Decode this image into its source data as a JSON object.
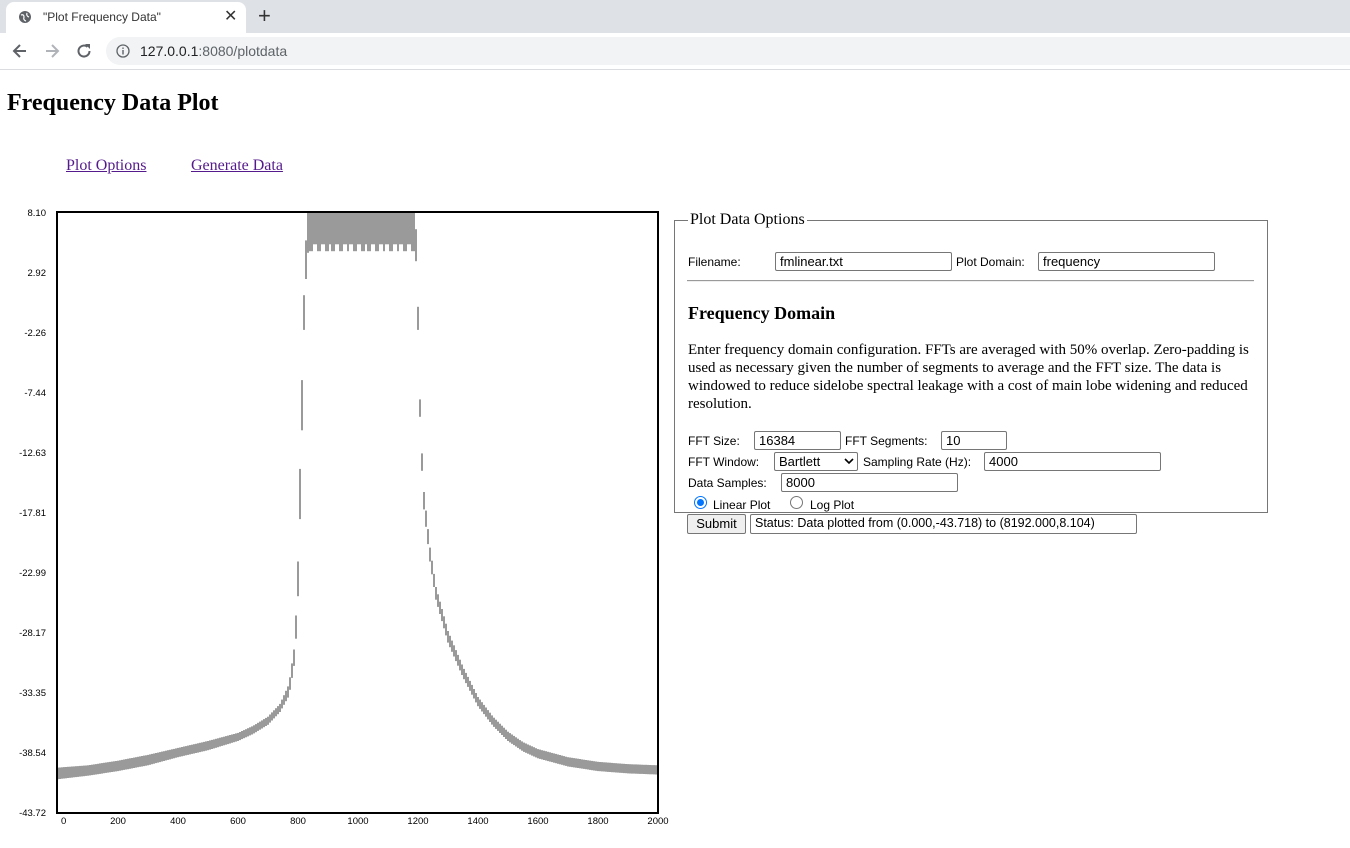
{
  "browser": {
    "tab_title": "\"Plot Frequency Data\"",
    "url_host": "127.0.0.1",
    "url_path": ":8080/plotdata"
  },
  "page": {
    "title": "Frequency Data Plot",
    "nav": [
      "Plot Options",
      "Generate Data"
    ]
  },
  "options": {
    "legend": "Plot Data Options",
    "filename_label": "Filename:",
    "filename_value": "fmlinear.txt",
    "domain_label": "Plot Domain:",
    "domain_value": "frequency",
    "section_title": "Frequency Domain",
    "description": "Enter frequency domain configuration. FFTs are averaged with 50% overlap. Zero-padding is used as necessary given the number of segments to average and the FFT size. The data is windowed to reduce sidelobe spectral leakage with a cost of main lobe widening and reduced resolution.",
    "fft_size_label": "FFT Size:",
    "fft_size_value": "16384",
    "fft_segments_label": "FFT Segments:",
    "fft_segments_value": "10",
    "fft_window_label": "FFT Window:",
    "fft_window_value": "Bartlett",
    "sampling_rate_label": "Sampling Rate (Hz):",
    "sampling_rate_value": "4000",
    "data_samples_label": "Data Samples:",
    "data_samples_value": "8000",
    "linear_label": "Linear Plot",
    "log_label": "Log Plot",
    "selected_scale": "linear",
    "submit_label": "Submit",
    "status_value": "Status: Data plotted from (0.000,-43.718) to (8192.000,8.104)"
  },
  "chart_data": {
    "type": "line",
    "title": "",
    "xlabel": "",
    "ylabel": "",
    "xlim": [
      0,
      2000
    ],
    "ylim": [
      -43.72,
      8.1
    ],
    "x_ticks": [
      0,
      200,
      400,
      600,
      800,
      1000,
      1200,
      1400,
      1600,
      1800,
      2000
    ],
    "y_ticks": [
      8.1,
      2.92,
      -2.26,
      -7.44,
      -12.63,
      -17.81,
      -22.99,
      -28.17,
      -33.35,
      -38.54,
      -43.72
    ],
    "color": "#808080",
    "series": [
      {
        "x": [
          0,
          100,
          200,
          300,
          400,
          500,
          600,
          650,
          700,
          740,
          770,
          790,
          800,
          810,
          820,
          830,
          840,
          850,
          1150,
          1190,
          1195,
          1200,
          1205,
          1210,
          1220,
          1240,
          1260,
          1300,
          1350,
          1400,
          1450,
          1500,
          1550,
          1600,
          1700,
          1800,
          1900,
          2000
        ],
        "y_low": [
          -40.8,
          -40.5,
          -40.1,
          -39.6,
          -38.9,
          -38.3,
          -37.5,
          -36.9,
          -36.1,
          -35.0,
          -33.6,
          -30.5,
          -25,
          -15,
          -2,
          4.6,
          4.8,
          4.8,
          4.8,
          4.8,
          3.5,
          -2,
          -8,
          -12.5,
          -17.5,
          -22,
          -25.3,
          -29.0,
          -32.0,
          -34.5,
          -36.2,
          -37.5,
          -38.4,
          -39.0,
          -39.7,
          -40.1,
          -40.3,
          -40.4
        ],
        "y_high": [
          -39.8,
          -39.6,
          -39.2,
          -38.7,
          -38.1,
          -37.5,
          -36.8,
          -36.2,
          -35.4,
          -34.3,
          -32.6,
          -29.0,
          -22,
          -10,
          1,
          8.1,
          8.1,
          8.1,
          8.1,
          8.1,
          6.0,
          0,
          -6.5,
          -11.0,
          -16.0,
          -20.8,
          -24.2,
          -28.0,
          -31.1,
          -33.7,
          -35.4,
          -36.7,
          -37.6,
          -38.2,
          -38.9,
          -39.3,
          -39.5,
          -39.6
        ]
      }
    ]
  }
}
